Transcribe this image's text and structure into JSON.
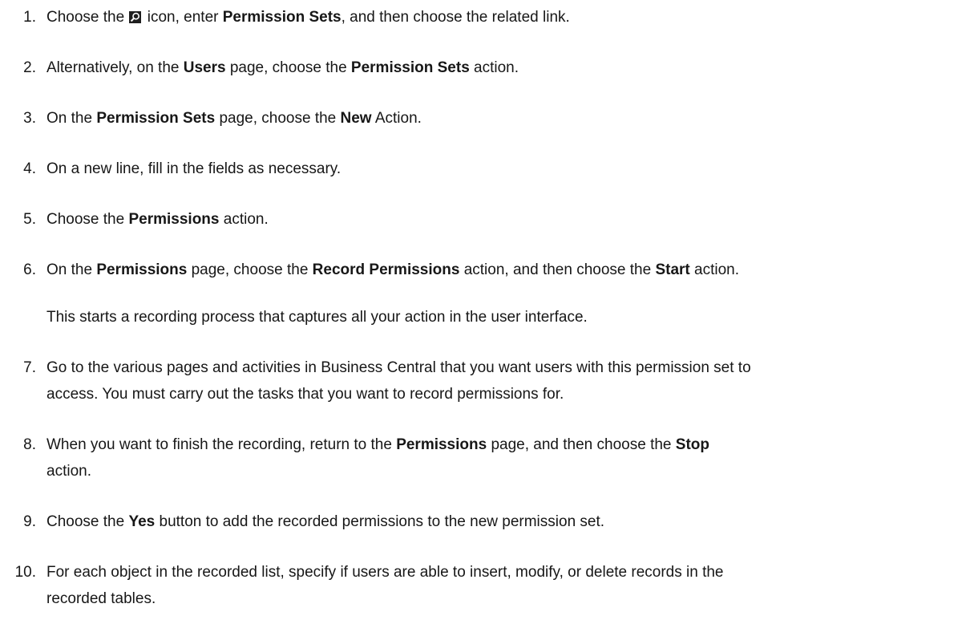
{
  "steps": [
    {
      "number": "1.",
      "parts": {
        "a": "Choose the ",
        "b": " icon, enter ",
        "c": "Permission Sets",
        "d": ", and then choose the related link."
      },
      "icon": "search-icon"
    },
    {
      "number": "2.",
      "parts": {
        "a": "Alternatively, on the ",
        "b": "Users",
        "c": " page, choose the ",
        "d": "Permission Sets",
        "e": " action."
      }
    },
    {
      "number": "3.",
      "parts": {
        "a": "On the ",
        "b": "Permission Sets",
        "c": " page, choose the ",
        "d": "New",
        "e": " Action."
      }
    },
    {
      "number": "4.",
      "parts": {
        "a": "On a new line, fill in the fields as necessary."
      }
    },
    {
      "number": "5.",
      "parts": {
        "a": "Choose the ",
        "b": "Permissions",
        "c": " action."
      }
    },
    {
      "number": "6.",
      "parts": {
        "a": "On the ",
        "b": "Permissions",
        "c": " page, choose the ",
        "d": "Record Permissions",
        "e": " action, and then choose the ",
        "f": "Start",
        "g": " action."
      },
      "note": "This starts a recording process that captures all your action in the user interface."
    },
    {
      "number": "7.",
      "parts": {
        "line1": "Go to the various pages and activities in Business Central that you want users with this permission set to",
        "line2": "access. You must carry out the tasks that you want to record permissions for."
      }
    },
    {
      "number": "8.",
      "parts": {
        "a": "When you want to finish the recording, return to the ",
        "b": "Permissions",
        "c": " page, and then choose the ",
        "d": "Stop",
        "line2": "action."
      }
    },
    {
      "number": "9.",
      "parts": {
        "a": "Choose the ",
        "b": "Yes",
        "c": " button to add the recorded permissions to the new permission set."
      }
    },
    {
      "number": "10.",
      "parts": {
        "line1": "For each object in the recorded list, specify if users are able to insert, modify, or delete records in the",
        "line2": "recorded tables."
      }
    }
  ]
}
